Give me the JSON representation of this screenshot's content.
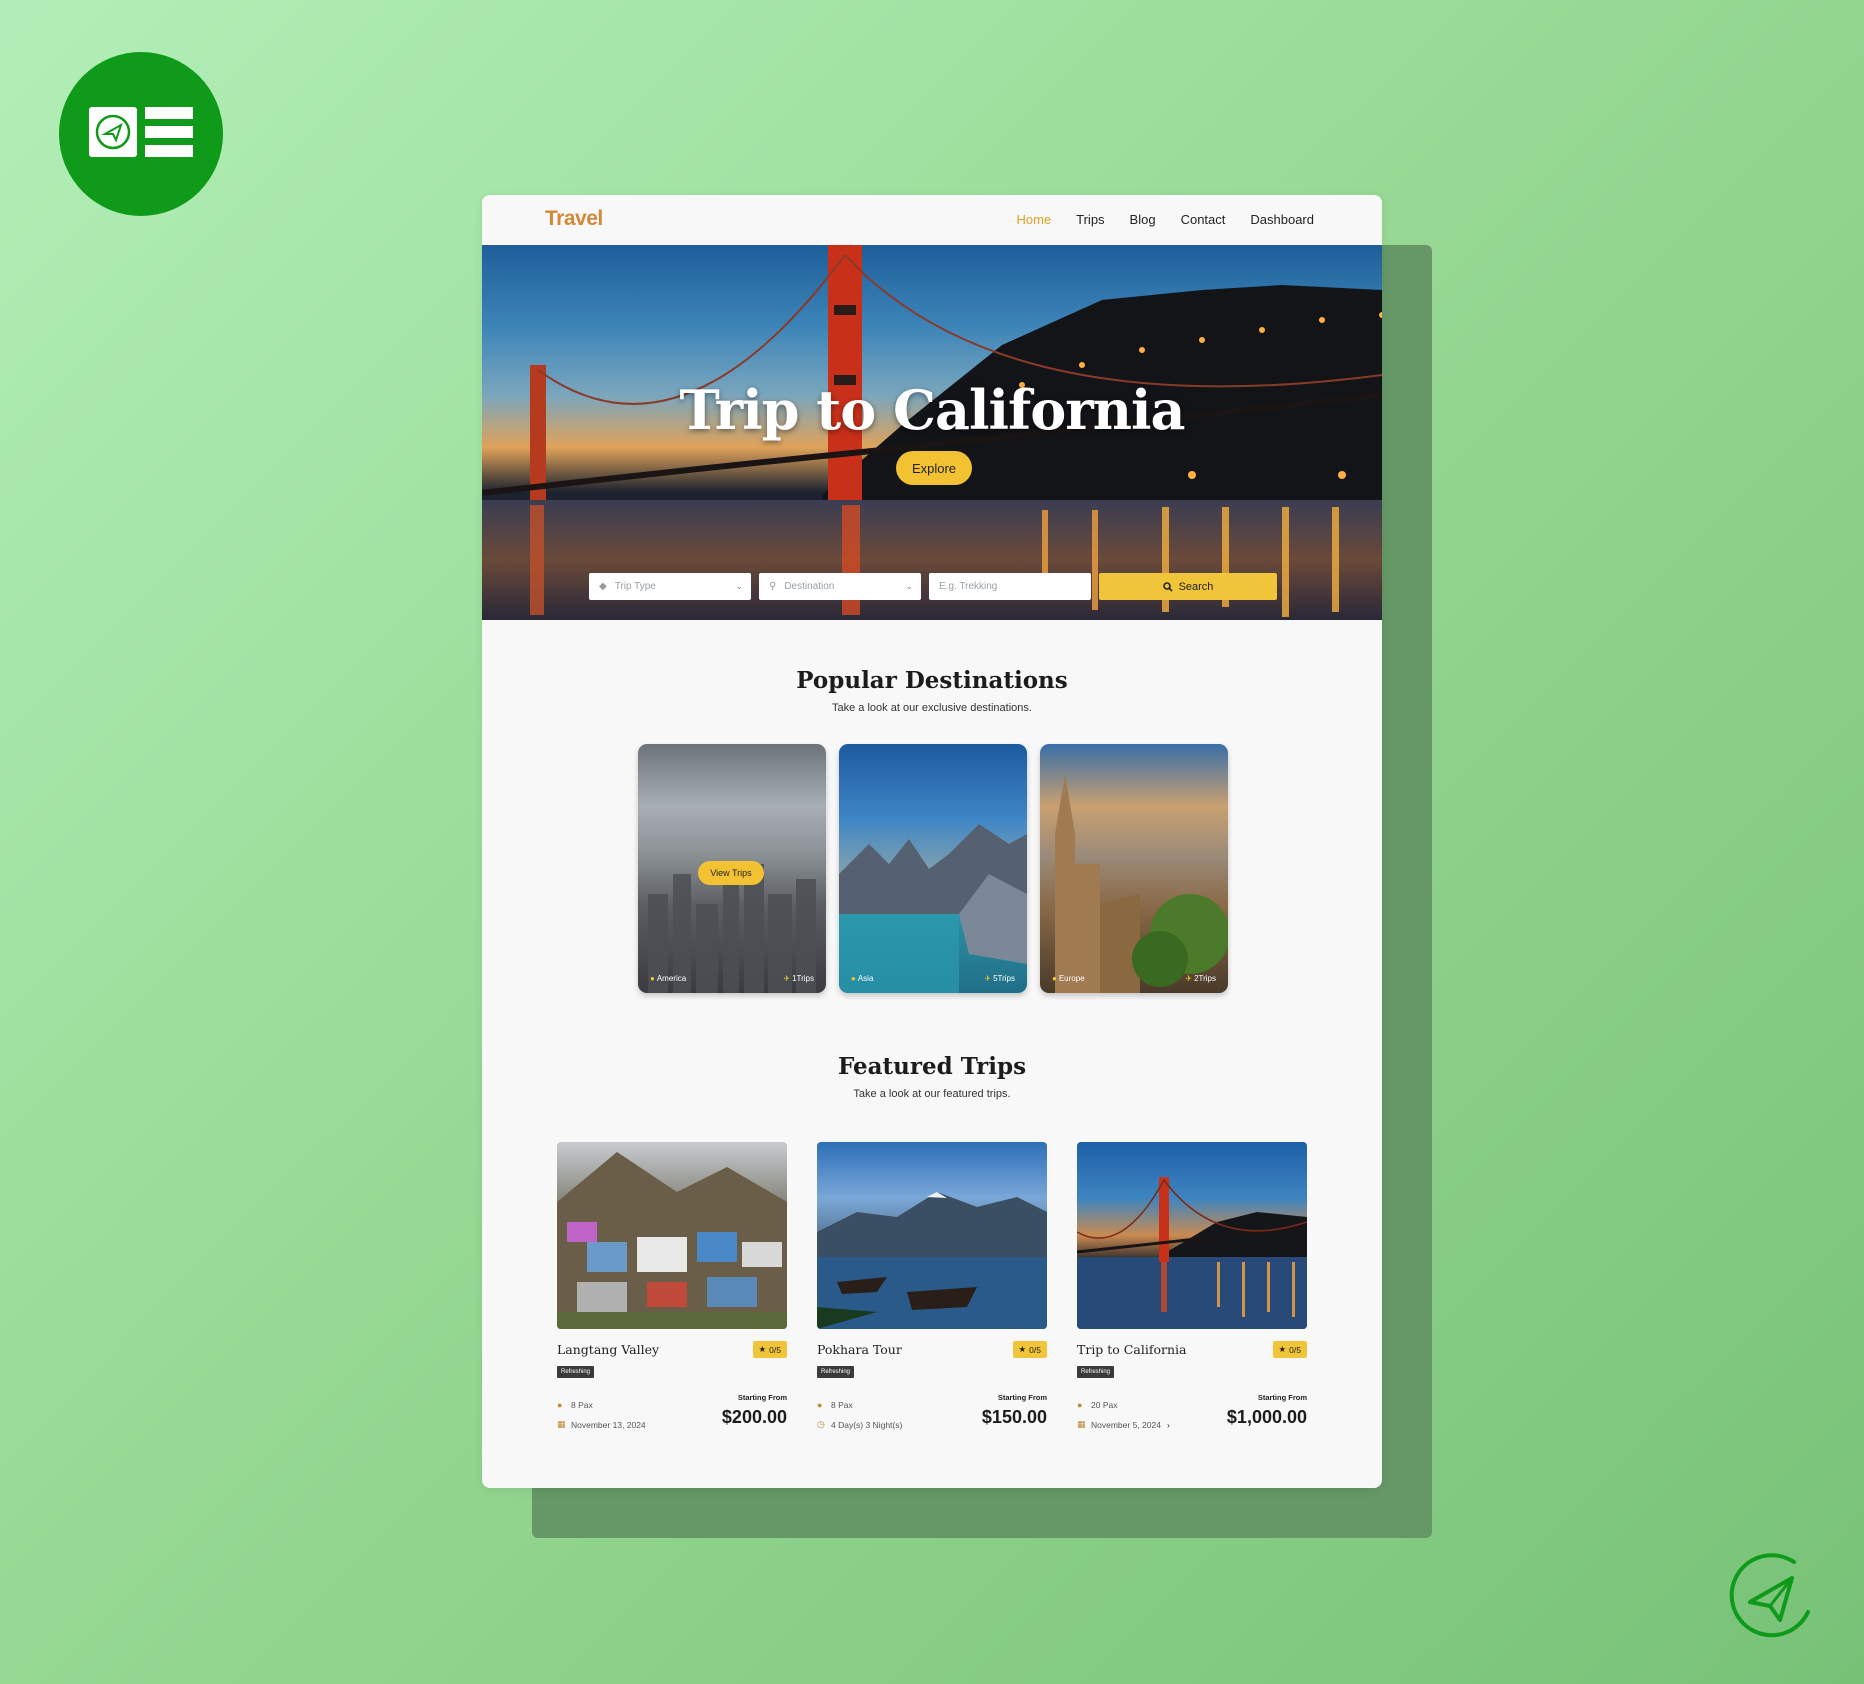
{
  "nav": {
    "brand": "Travel",
    "links": [
      "Home",
      "Trips",
      "Blog",
      "Contact",
      "Dashboard"
    ],
    "active": "Home"
  },
  "hero": {
    "title": "Trip to California",
    "explore_label": "Explore",
    "search": {
      "trip_type_placeholder": "Trip Type",
      "destination_placeholder": "Destination",
      "keyword_placeholder": "E.g. Trekking",
      "search_label": "Search"
    }
  },
  "popular": {
    "title": "Popular Destinations",
    "subtitle": "Take a look at our exclusive destinations.",
    "view_trips_label": "View Trips",
    "destinations": [
      {
        "name": "America",
        "trips": "1Trips"
      },
      {
        "name": "Asia",
        "trips": "5Trips"
      },
      {
        "name": "Europe",
        "trips": "2Trips"
      }
    ]
  },
  "featured": {
    "title": "Featured Trips",
    "subtitle": "Take a look at our featured trips.",
    "starting_from_label": "Starting From",
    "trips": [
      {
        "name": "Langtang Valley",
        "rating": "0/5",
        "tag": "Refreshing",
        "pax": "8 Pax",
        "detail": "November 13, 2024",
        "detail_icon": "calendar-icon",
        "price": "$200.00"
      },
      {
        "name": "Pokhara Tour",
        "rating": "0/5",
        "tag": "Refreshing",
        "pax": "8 Pax",
        "detail": "4 Day(s) 3 Night(s)",
        "detail_icon": "clock-icon",
        "price": "$150.00"
      },
      {
        "name": "Trip to California",
        "rating": "0/5",
        "tag": "Refreshing",
        "pax": "20 Pax",
        "detail": "November 5, 2024",
        "detail_icon": "calendar-icon",
        "price": "$1,000.00"
      }
    ]
  },
  "colors": {
    "brand": "#d08a3a",
    "accent_yellow": "#f0c53a",
    "logo_green": "#0f9a1a",
    "background_green": "#97d994"
  }
}
